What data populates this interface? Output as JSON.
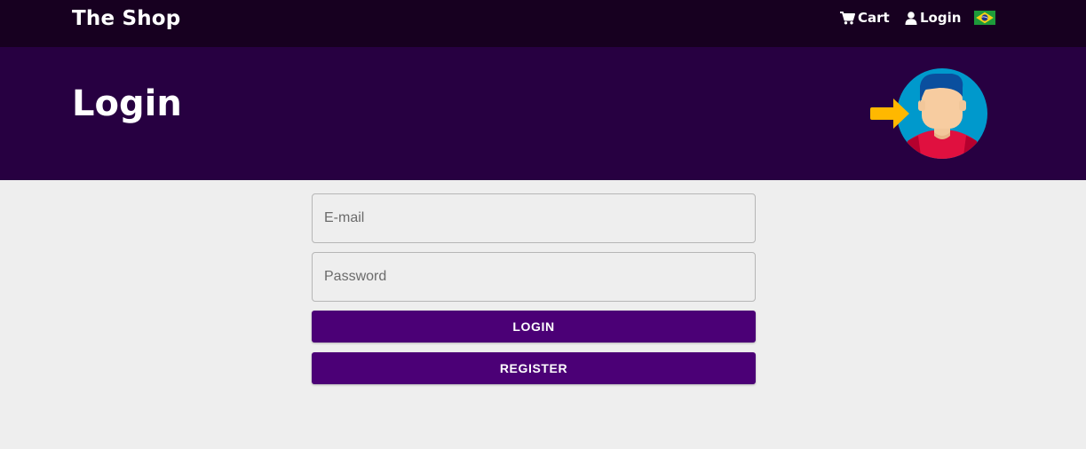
{
  "navbar": {
    "brand": "The Shop",
    "cart_label": "Cart",
    "login_label": "Login",
    "cart_icon": "cart-icon",
    "login_icon": "user-icon",
    "language_flag": "brazil-flag"
  },
  "hero": {
    "title": "Login",
    "illustration": "user-login-illustration"
  },
  "form": {
    "email_placeholder": "E-mail",
    "password_placeholder": "Password",
    "login_button": "LOGIN",
    "register_button": "REGISTER"
  },
  "colors": {
    "navbar_bg": "#170020",
    "hero_bg": "#270041",
    "button_bg": "#4b0076",
    "page_bg": "#eeeeee"
  }
}
